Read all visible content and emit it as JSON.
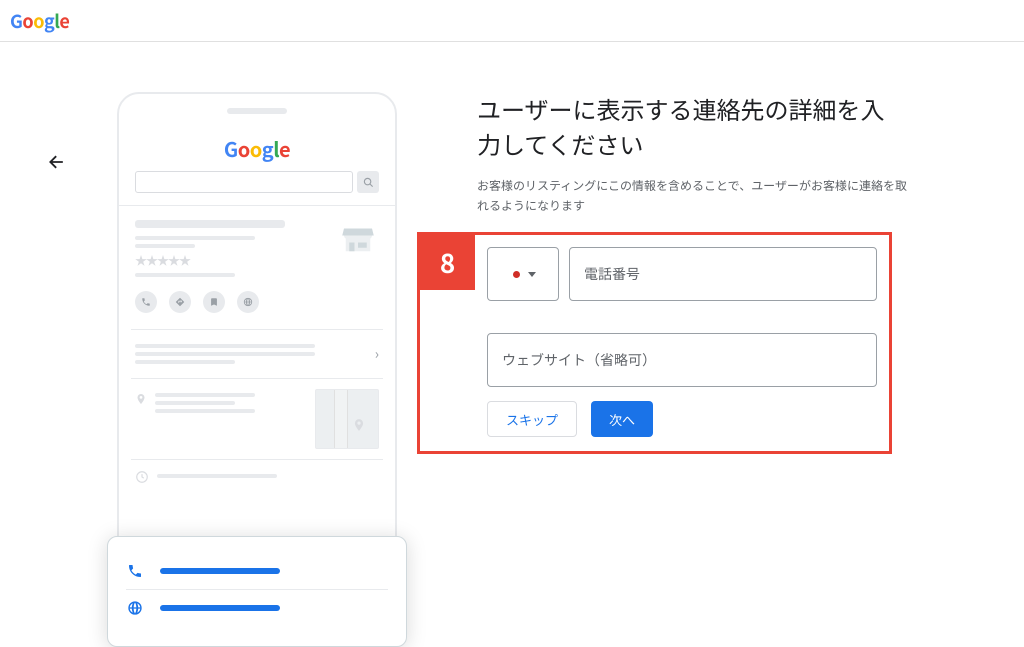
{
  "header": {
    "logo_text": "Google"
  },
  "illustration": {
    "logo": "Google",
    "popup": {
      "rows": [
        {
          "icon": "phone"
        },
        {
          "icon": "globe"
        }
      ]
    }
  },
  "form": {
    "step_number": "8",
    "title": "ユーザーに表示する連絡先の詳細を入力してください",
    "subtitle": "お客様のリスティングにこの情報を含めることで、ユーザーがお客様に連絡を取れるようになります",
    "phone_placeholder": "電話番号",
    "website_placeholder": "ウェブサイト（省略可）",
    "skip_label": "スキップ",
    "next_label": "次へ",
    "country_code": "JP"
  }
}
